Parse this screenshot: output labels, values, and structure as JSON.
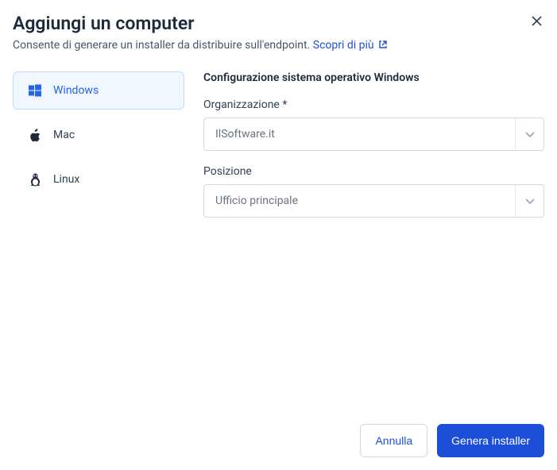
{
  "header": {
    "title": "Aggiungi un computer",
    "subtitle": "Consente di generare un installer da distribuire sull'endpoint.",
    "learn_more": "Scopri di più"
  },
  "tabs": {
    "windows": "Windows",
    "mac": "Mac",
    "linux": "Linux"
  },
  "config": {
    "section_title": "Configurazione sistema operativo Windows",
    "org_label": "Organizzazione *",
    "org_value": "IlSoftware.it",
    "pos_label": "Posizione",
    "pos_value": "Ufficio principale"
  },
  "footer": {
    "cancel": "Annulla",
    "generate": "Genera installer"
  }
}
